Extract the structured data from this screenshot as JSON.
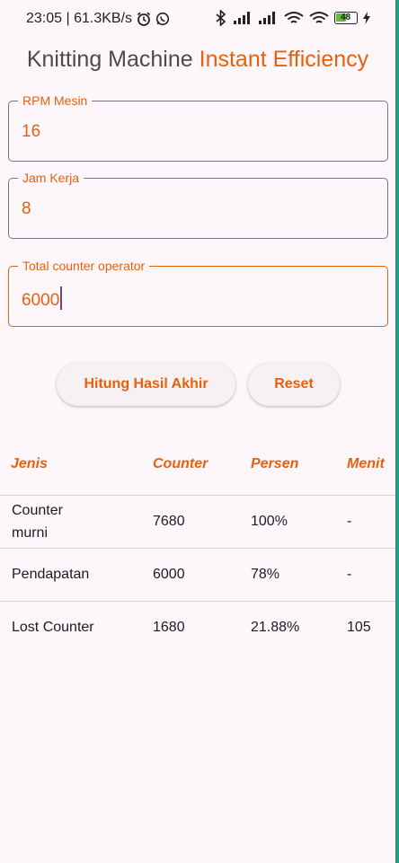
{
  "status_bar": {
    "time_speed": "23:05 | 61.3KB/s",
    "battery_level": "48"
  },
  "title": {
    "part1": "Knitting Machine",
    "part2": "Instant Efficiency"
  },
  "fields": {
    "rpm": {
      "label": "RPM Mesin",
      "value": "16"
    },
    "jam": {
      "label": "Jam Kerja",
      "value": "8"
    },
    "counter": {
      "label": "Total counter operator",
      "value": "6000"
    }
  },
  "buttons": {
    "calculate": "Hitung Hasil Akhir",
    "reset": "Reset"
  },
  "table": {
    "headers": [
      "Jenis",
      "Counter",
      "Persen",
      "Menit"
    ],
    "rows": [
      {
        "jenis_line1": "Counter",
        "jenis_line2": "murni",
        "counter": "7680",
        "persen": "100%",
        "menit": "-"
      },
      {
        "jenis": "Pendapatan",
        "counter": "6000",
        "persen": "78%",
        "menit": "-"
      },
      {
        "jenis": "Lost Counter",
        "counter": "1680",
        "persen": "21.88%",
        "menit": "105"
      }
    ]
  },
  "colors": {
    "accent": "#e8600c",
    "background": "#fdf7fb"
  }
}
